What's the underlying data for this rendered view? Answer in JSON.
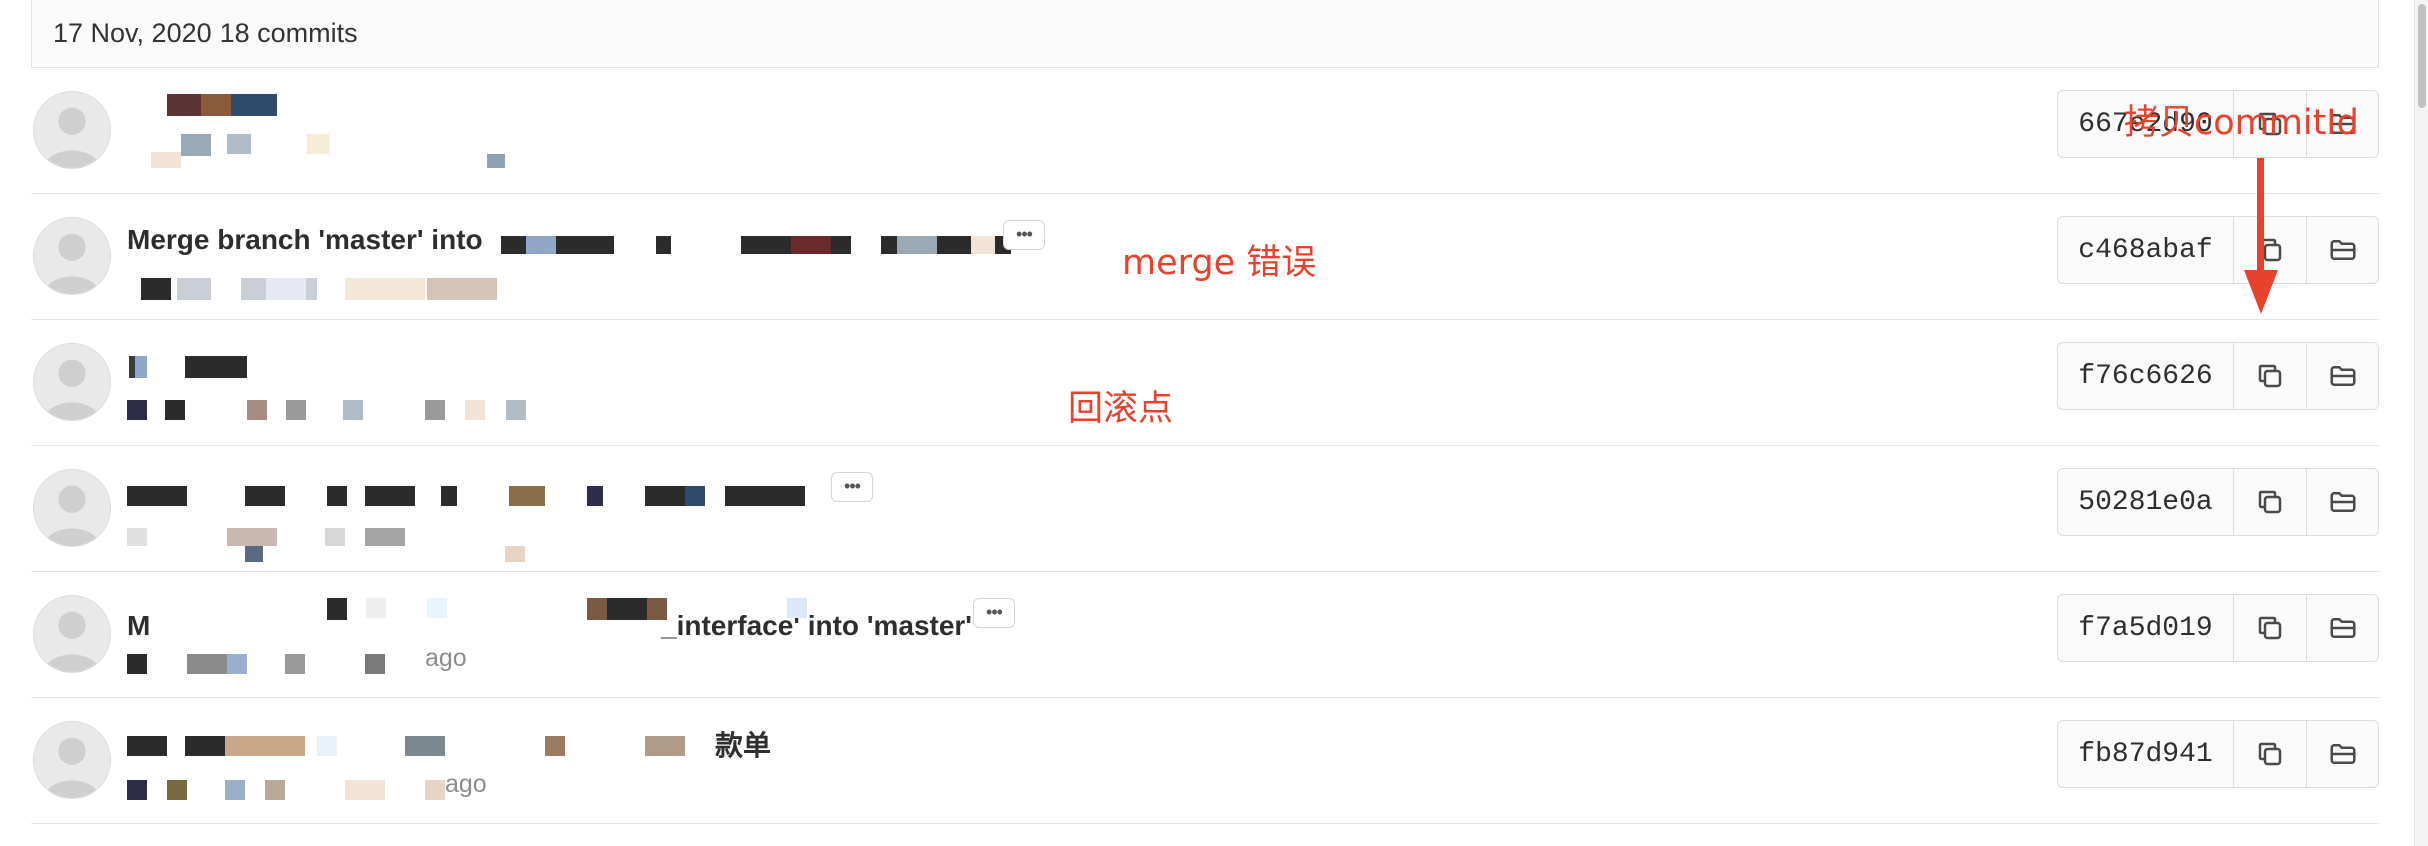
{
  "day_header": {
    "date": "17 Nov, 2020",
    "count": "18 commits"
  },
  "commits": [
    {
      "title": "",
      "meta": "",
      "sha": "667e2d90"
    },
    {
      "title": "Merge branch 'master' into",
      "meta": "",
      "sha": "c468abaf"
    },
    {
      "title": "",
      "meta": "",
      "sha": "f76c6626"
    },
    {
      "title": "",
      "meta": "",
      "sha": "50281e0a"
    },
    {
      "title": "M",
      "title_tail": "_interface' into 'master'",
      "meta": "ago",
      "sha": "f7a5d019"
    },
    {
      "title_tail": "款单",
      "meta": "ago",
      "sha": "fb87d941"
    }
  ],
  "annotations": {
    "copy_commit_id": "拷贝commitId",
    "merge_error": "merge 错误",
    "rollback_point": "回滚点"
  },
  "icons": {
    "copy": "copy-icon",
    "browse": "folder-open-icon",
    "more": "ellipsis-icon"
  },
  "colors": {
    "annotation": "#e8412c",
    "border": "#e5e5e5"
  }
}
